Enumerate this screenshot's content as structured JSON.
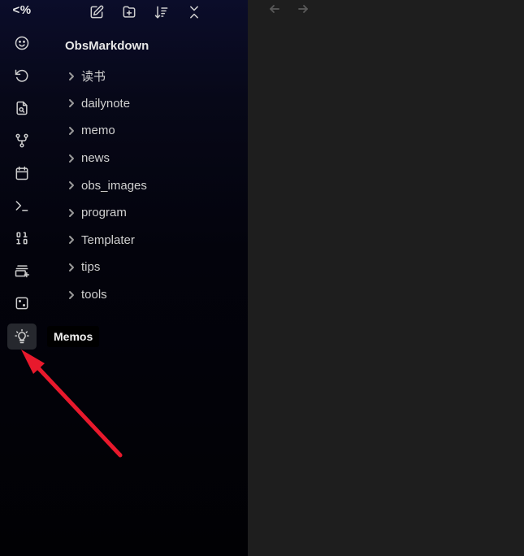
{
  "ribbon": {
    "top_label": "<%",
    "buttons": [
      {
        "icon": "smiley-icon"
      },
      {
        "icon": "rotate-ccw-icon"
      },
      {
        "icon": "file-search-icon"
      },
      {
        "icon": "git-fork-icon"
      },
      {
        "icon": "calendar-icon"
      },
      {
        "icon": "terminal-icon"
      },
      {
        "icon": "binary-icon"
      },
      {
        "icon": "list-plus-icon"
      },
      {
        "icon": "dice-icon"
      },
      {
        "icon": "lightbulb-icon",
        "active": true
      }
    ]
  },
  "nav_actions": [
    "new-note-icon",
    "new-folder-icon",
    "sort-icon",
    "collapse-all-icon"
  ],
  "vault": {
    "title": "ObsMarkdown",
    "folders": [
      "读书",
      "dailynote",
      "memo",
      "news",
      "obs_images",
      "program",
      "Templater",
      "tips",
      "tools"
    ]
  },
  "tooltip": {
    "text": "Memos"
  },
  "annotation": {
    "color": "#e8192c"
  },
  "right_pane": {
    "back_icon": "arrow-left-icon",
    "forward_icon": "arrow-right-icon"
  }
}
